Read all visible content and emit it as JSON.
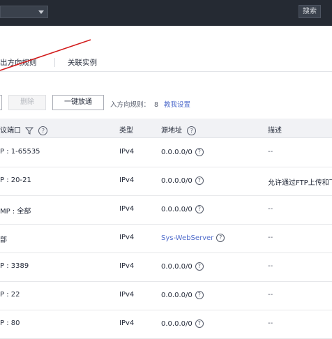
{
  "topbar": {
    "search_label": "搜索"
  },
  "tabs": [
    {
      "label": "出方向规则"
    },
    {
      "label": "关联实例"
    }
  ],
  "toolbar": {
    "delete_label": "删除",
    "oneclick_label": "一键放通",
    "inbound_rules_label": "入方向规则：",
    "inbound_rules_count": "8",
    "teach_link": "教我设置"
  },
  "table": {
    "headers": {
      "protocol_port": "议端口",
      "type": "类型",
      "source": "源地址",
      "description": "描述"
    },
    "rows": [
      {
        "protocol_port": "P : 1-65535",
        "type": "IPv4",
        "source": "0.0.0.0/0",
        "source_is_link": false,
        "description": "--"
      },
      {
        "protocol_port": "P : 20-21",
        "type": "IPv4",
        "source": "0.0.0.0/0",
        "source_is_link": false,
        "description": "允许通过FTP上传和下"
      },
      {
        "protocol_port": "MP : 全部",
        "type": "IPv4",
        "source": "0.0.0.0/0",
        "source_is_link": false,
        "description": "--"
      },
      {
        "protocol_port": "部",
        "type": "IPv4",
        "source": "Sys-WebServer",
        "source_is_link": true,
        "description": "--"
      },
      {
        "protocol_port": "P : 3389",
        "type": "IPv4",
        "source": "0.0.0.0/0",
        "source_is_link": false,
        "description": "--"
      },
      {
        "protocol_port": "P : 22",
        "type": "IPv4",
        "source": "0.0.0.0/0",
        "source_is_link": false,
        "description": "--"
      },
      {
        "protocol_port": "P : 80",
        "type": "IPv4",
        "source": "0.0.0.0/0",
        "source_is_link": false,
        "description": "--"
      }
    ]
  },
  "icons": {
    "help": "question-circle-icon",
    "filter": "filter-icon",
    "dropdown": "chevron-down-icon"
  },
  "colors": {
    "topbar": "#252a33",
    "link": "#526ecc",
    "header_bg": "#f1f2f5",
    "annotation_line": "#d21a1a"
  }
}
